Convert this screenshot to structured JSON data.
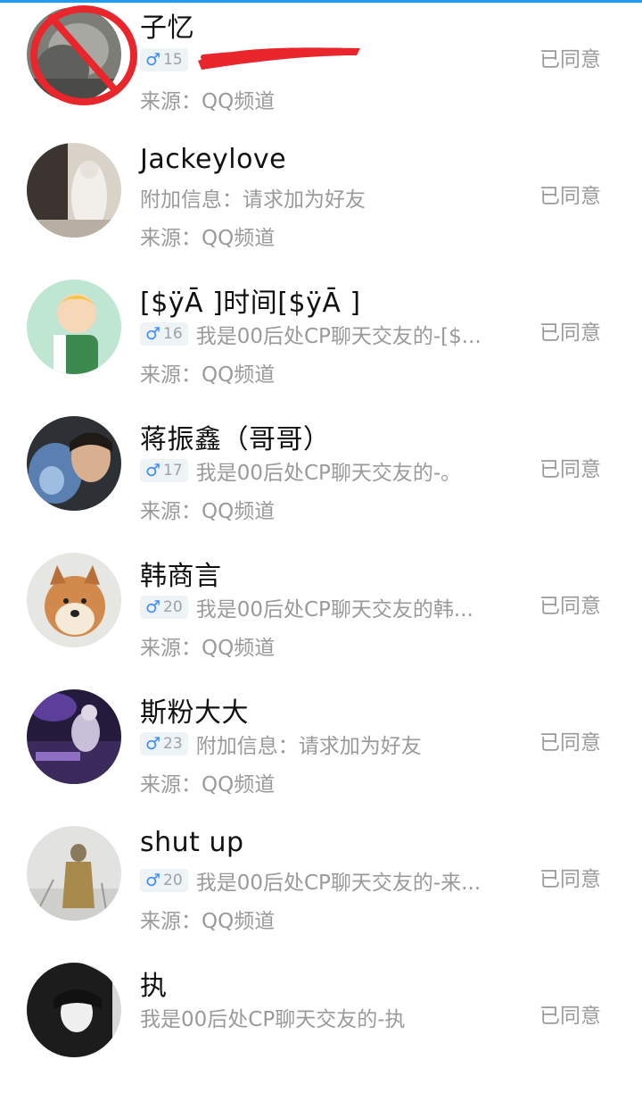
{
  "requests": [
    {
      "name": "子忆",
      "age": "15",
      "gender_icon": "male-icon",
      "message": "",
      "source": "来源：QQ频道",
      "status": "已同意",
      "avatar_marker": "red-prohibition-scribble"
    },
    {
      "name": "Jackeylove",
      "age": "",
      "message": "附加信息：请求加为好友",
      "source": "来源：QQ频道",
      "status": "已同意"
    },
    {
      "name": "[$ÿĀ  ]时间[$ÿĀ  ]",
      "age": "16",
      "gender_icon": "male-icon",
      "message": "我是00后处CP聊天交友的-[$...",
      "source": "来源：QQ频道",
      "status": "已同意"
    },
    {
      "name": "蒋振鑫（哥哥）",
      "age": "17",
      "gender_icon": "male-icon",
      "message": "我是00后处CP聊天交友的-。",
      "source": "来源：QQ频道",
      "status": "已同意"
    },
    {
      "name": "韩商言",
      "age": "20",
      "gender_icon": "male-icon",
      "message": "我是00后处CP聊天交友的韩...",
      "source": "来源：QQ频道",
      "status": "已同意"
    },
    {
      "name": "斯粉大大",
      "age": "23",
      "gender_icon": "male-icon",
      "message": "附加信息：请求加为好友",
      "source": "来源：QQ频道",
      "status": "已同意"
    },
    {
      "name": "shut  up",
      "age": "20",
      "gender_icon": "male-icon",
      "message": "我是00后处CP聊天交友的-来...",
      "source": "来源：QQ频道",
      "status": "已同意"
    },
    {
      "name": "执",
      "age": "",
      "message": "我是00后处CP聊天交友的-执",
      "source": "",
      "status": "已同意"
    }
  ],
  "colors": {
    "accent": "#3d8bff",
    "secondary_text": "#9a9a9a",
    "primary_text": "#111111",
    "redaction": "#e8262c"
  }
}
